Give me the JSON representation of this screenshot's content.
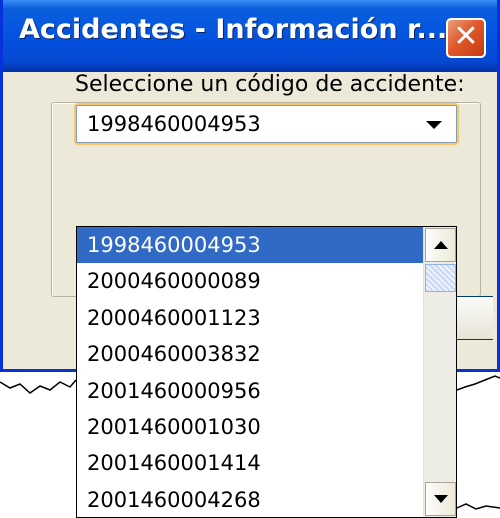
{
  "window": {
    "title": "Accidentes - Información r...",
    "close_icon": "close-icon",
    "titlebar_color": "#0453e0",
    "close_color": "#e2582c"
  },
  "form": {
    "prompt": "Seleccione un código de accidente:",
    "selected_value": "1998460004953"
  },
  "dropdown": {
    "selected_color": "#316ac5",
    "items": [
      "1998460004953",
      "2000460000089",
      "2000460001123",
      "2000460003832",
      "2001460000956",
      "2001460001030",
      "2001460001414",
      "2001460004268"
    ],
    "selected_index": 0,
    "scroll_up_icon": "scroll-up-arrow-icon",
    "scroll_down_icon": "scroll-down-arrow-icon"
  }
}
